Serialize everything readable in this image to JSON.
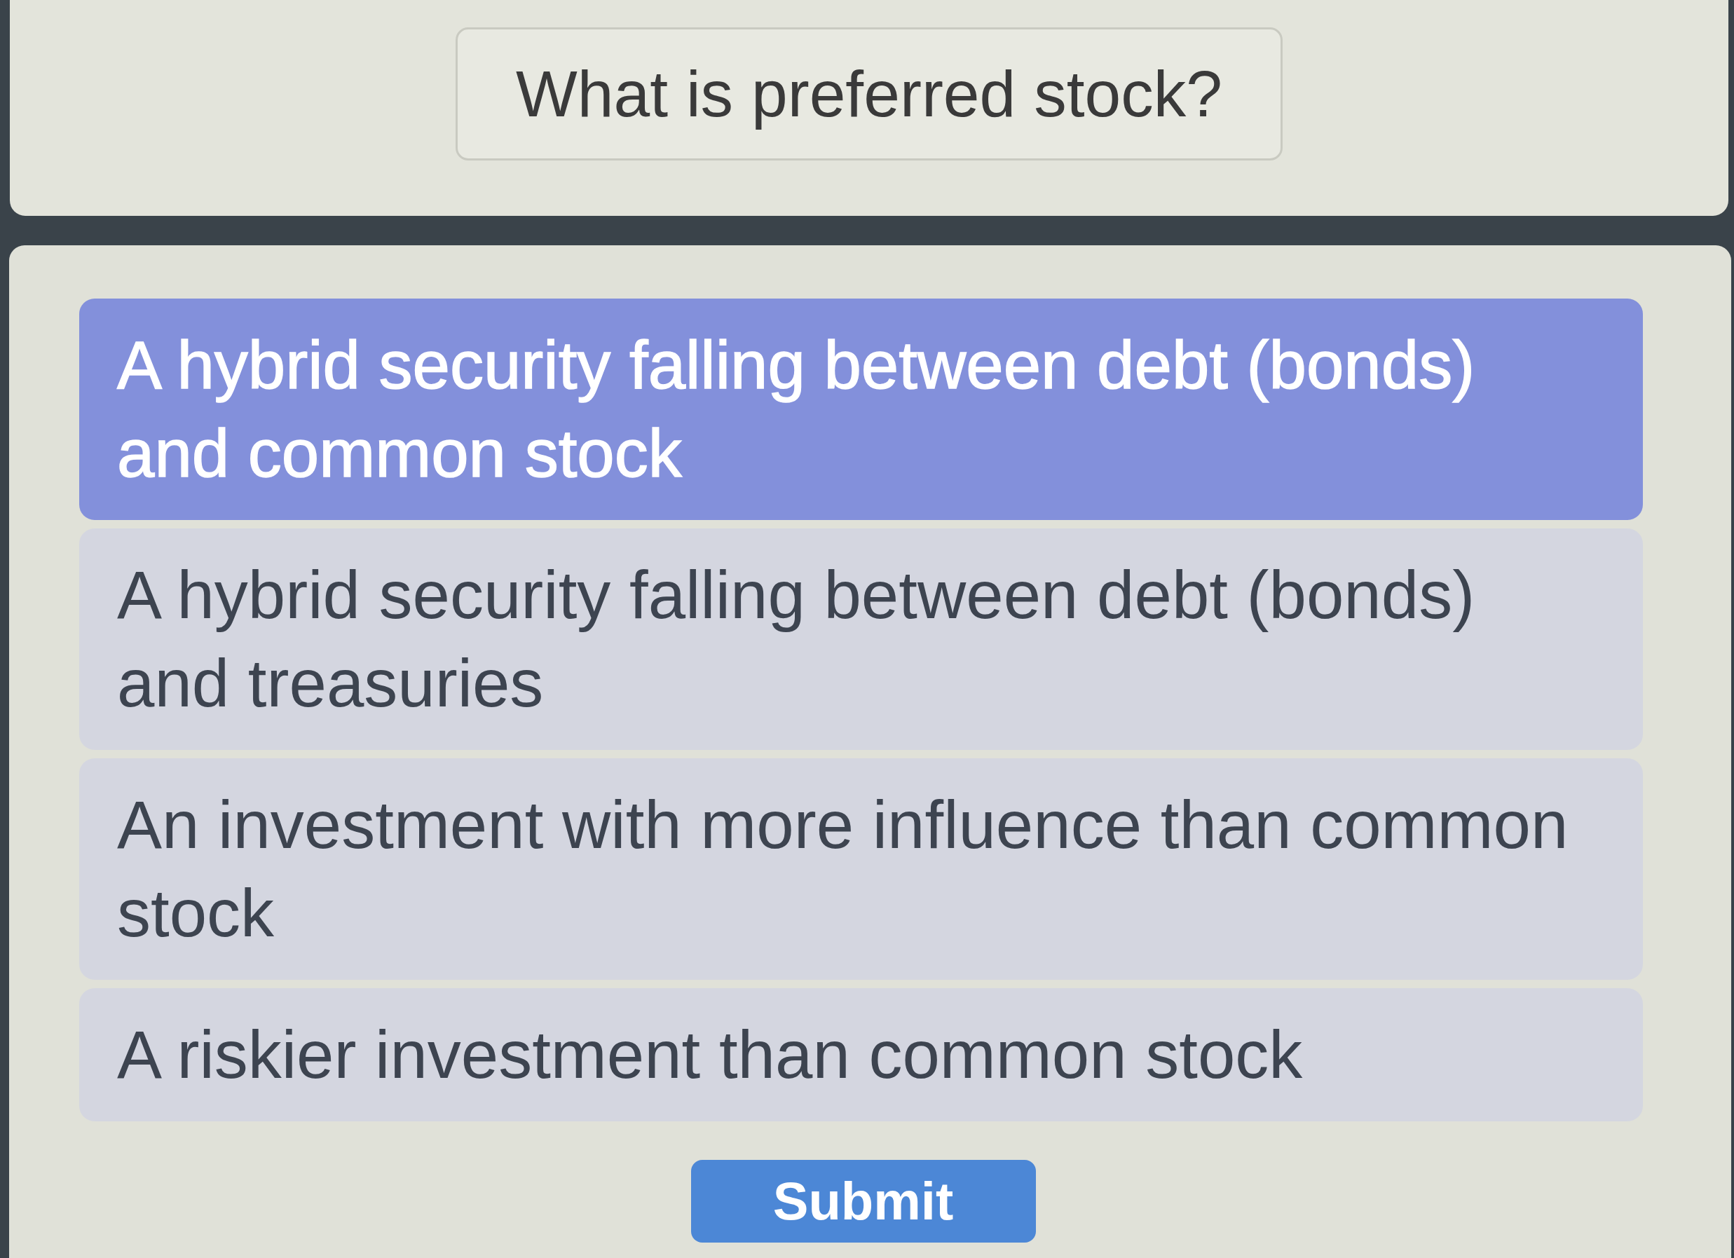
{
  "question": "What is preferred stock?",
  "options": [
    {
      "text": "A hybrid security falling between debt (bonds) and common stock",
      "selected": true
    },
    {
      "text": "A hybrid security falling between debt (bonds) and treasuries",
      "selected": false
    },
    {
      "text": "An investment with more influence than common stock",
      "selected": false
    },
    {
      "text": "A riskier investment than common stock",
      "selected": false
    }
  ],
  "submit_button": {
    "label": "Submit"
  }
}
